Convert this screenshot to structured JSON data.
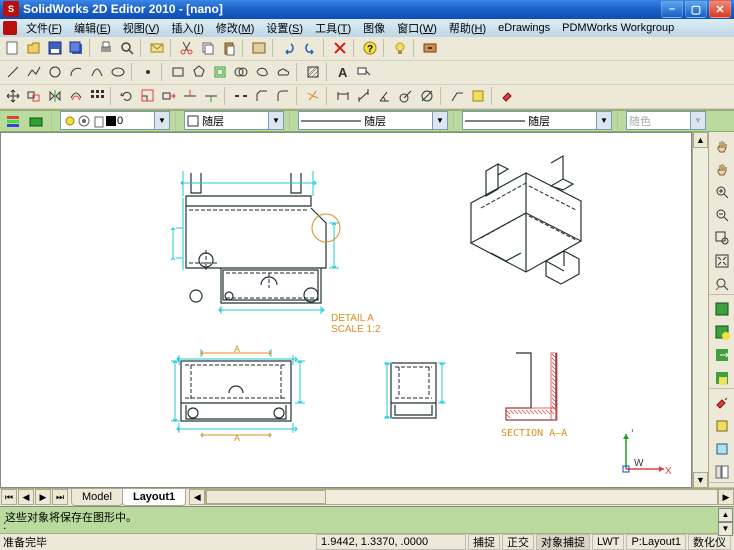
{
  "titlebar": {
    "text": "SolidWorks 2D Editor 2010 - [nano]"
  },
  "menus": {
    "file": {
      "label": "文件",
      "hot": "F"
    },
    "edit": {
      "label": "编辑",
      "hot": "E"
    },
    "view": {
      "label": "视图",
      "hot": "V"
    },
    "insert": {
      "label": "插入",
      "hot": "I"
    },
    "modify": {
      "label": "修改",
      "hot": "M"
    },
    "settings": {
      "label": "设置",
      "hot": "S"
    },
    "tools": {
      "label": "工具",
      "hot": "T"
    },
    "image": {
      "label": "图像"
    },
    "window": {
      "label": "窗口",
      "hot": "W"
    },
    "help": {
      "label": "帮助",
      "hot": "H"
    },
    "edrawings": {
      "label": "eDrawings"
    },
    "pdm": {
      "label": "PDMWorks Workgroup"
    }
  },
  "layers": {
    "status": "0",
    "combo1": "随层",
    "combo2": "随层",
    "combo3": "随层",
    "combo4": "随色"
  },
  "drawing": {
    "detail_label": "DETAIL A",
    "detail_scale": "SCALE 1:2",
    "section_label": "SECTION A–A",
    "dim_a": "A",
    "ucs_w": "W",
    "ucs_x": "X",
    "ucs_y": "Y"
  },
  "tabs": {
    "model": "Model",
    "layout": "Layout1"
  },
  "message": {
    "text": "这些对象将保存在图形中。",
    "prompt": ":"
  },
  "status": {
    "ready": "准备完毕",
    "coords": "1.9442, 1.3370, .0000",
    "snap": "捕捉",
    "ortho": "正交",
    "osnap": "对象捕捉",
    "lwt": "LWT",
    "layout": "P:Layout1",
    "digit": "数化仪"
  }
}
